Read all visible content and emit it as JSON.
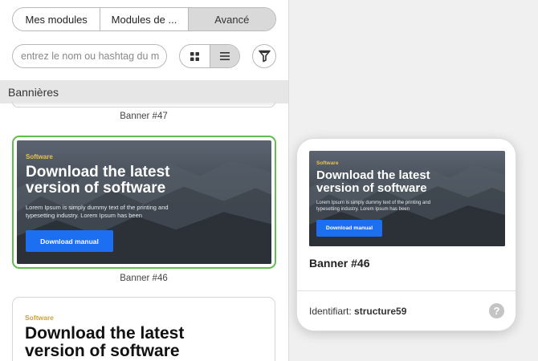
{
  "tabs": [
    {
      "label": "Mes modules",
      "active": false
    },
    {
      "label": "Modules de ...",
      "active": false
    },
    {
      "label": "Avancé",
      "active": true
    }
  ],
  "search": {
    "placeholder": "entrez le nom ou hashtag du m"
  },
  "view_toggle": {
    "grid_icon": "grid-icon",
    "list_icon": "list-icon",
    "active": "list"
  },
  "filter": {
    "icon": "funnel-icon"
  },
  "section": {
    "title": "Bannières"
  },
  "list": {
    "items": [
      {
        "caption": "Banner #47"
      },
      {
        "caption": "Banner #46",
        "selected": true
      }
    ],
    "partial_card": {
      "small": "Software",
      "title_line1": "Download the latest",
      "title_line2": "version of software"
    }
  },
  "banner": {
    "small": "Software",
    "title_line1": "Download the latest",
    "title_line2": "version of software",
    "text_line1": "Lorem Ipsum is simply dummy text of the printing and",
    "text_line2": "typesetting industry. Lorem Ipsum has been",
    "button": "Download manual"
  },
  "preview": {
    "title": "Banner #46",
    "id_label": "Identifiart:",
    "id_value": "structure59",
    "help": "?"
  },
  "colors": {
    "accent_green": "#5fbf4a",
    "button_blue": "#1d6ff2",
    "label_yellow": "#e8c24e"
  }
}
